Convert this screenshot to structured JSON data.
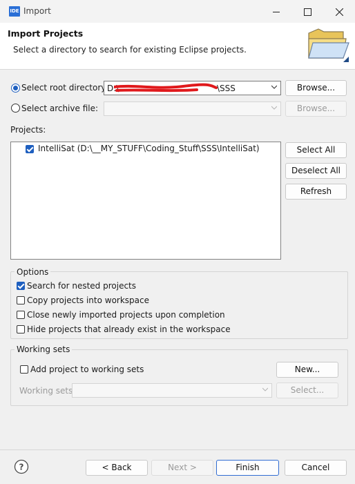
{
  "window": {
    "title": "Import",
    "app_icon_text": "IDE",
    "minimize_icon": "minimize-icon",
    "maximize_icon": "maximize-icon",
    "close_icon": "close-icon"
  },
  "header": {
    "title": "Import Projects",
    "description": "Select a directory to search for existing Eclipse projects.",
    "image_icon": "open-folder-icon"
  },
  "source": {
    "root_radio_label": "Select root directory:",
    "root_selected": true,
    "root_value_prefix": "D:\\",
    "root_value_suffix": "\\SSS",
    "root_browse_label": "Browse...",
    "archive_radio_label": "Select archive file:",
    "archive_value": "",
    "archive_browse_label": "Browse..."
  },
  "projects": {
    "label": "Projects:",
    "items": [
      {
        "label": "IntelliSat (D:\\__MY_STUFF\\Coding_Stuff\\SSS\\IntelliSat)",
        "checked": true
      }
    ],
    "select_all_label": "Select All",
    "deselect_all_label": "Deselect All",
    "refresh_label": "Refresh"
  },
  "options": {
    "label": "Options",
    "items": [
      {
        "label": "Search for nested projects",
        "checked": true
      },
      {
        "label": "Copy projects into workspace",
        "checked": false
      },
      {
        "label": "Close newly imported projects upon completion",
        "checked": false
      },
      {
        "label": "Hide projects that already exist in the workspace",
        "checked": false
      }
    ]
  },
  "working_sets": {
    "label": "Working sets",
    "add_label": "Add project to working sets",
    "add_checked": false,
    "new_label": "New...",
    "sets_label": "Working sets:",
    "sets_value": "",
    "select_label": "Select..."
  },
  "footer": {
    "help_icon": "help-icon",
    "back_label": "< Back",
    "next_label": "Next >",
    "finish_label": "Finish",
    "cancel_label": "Cancel"
  },
  "colors": {
    "accent": "#1e5fbf",
    "default_button_border": "#2f6bd2",
    "redaction": "#e0191c"
  }
}
